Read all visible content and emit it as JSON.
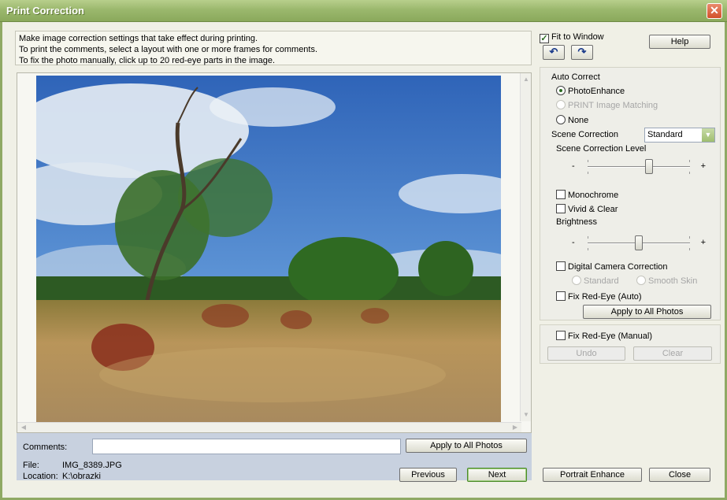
{
  "window": {
    "title": "Print Correction",
    "close_glyph": "✕"
  },
  "instructions": [
    "Make image correction settings that take effect during printing.",
    "To print the comments, select a layout with one or more frames for comments.",
    "To fix the photo manually, click up to 20 red-eye parts in the image."
  ],
  "view": {
    "fit_to_window_label": "Fit to Window",
    "fit_to_window_checked": true,
    "help_label": "Help",
    "rotate_left_glyph": "↶",
    "rotate_right_glyph": "↷"
  },
  "auto_correct": {
    "heading": "Auto Correct",
    "options": [
      {
        "label": "PhotoEnhance",
        "selected": true,
        "enabled": true
      },
      {
        "label": "PRINT Image Matching",
        "selected": false,
        "enabled": false
      },
      {
        "label": "None",
        "selected": false,
        "enabled": true
      }
    ],
    "scene_correction_label": "Scene Correction",
    "scene_correction_value": "Standard",
    "scene_level_label": "Scene Correction Level",
    "scene_level_value": 0.6,
    "monochrome_label": "Monochrome",
    "vivid_label": "Vivid & Clear",
    "brightness_label": "Brightness",
    "brightness_value": 0.5,
    "digital_camera_label": "Digital Camera Correction",
    "dc_options": [
      "Standard",
      "Smooth Skin"
    ],
    "fix_redeye_auto_label": "Fix Red-Eye (Auto)",
    "apply_all_label": "Apply to All Photos",
    "minus": "-",
    "plus": "+"
  },
  "manual": {
    "fix_redeye_manual_label": "Fix Red-Eye (Manual)",
    "undo_label": "Undo",
    "clear_label": "Clear"
  },
  "bottom": {
    "comments_label": "Comments:",
    "comments_value": "",
    "apply_all_label": "Apply to All Photos",
    "file_label": "File:",
    "file_value": "IMG_8389.JPG",
    "location_label": "Location:",
    "location_value": "K:\\obrazki",
    "previous_label": "Previous",
    "next_label": "Next"
  },
  "footer": {
    "portrait_enhance_label": "Portrait Enhance",
    "close_label": "Close"
  },
  "icons": {
    "scroll_up": "▲",
    "scroll_down": "▼",
    "scroll_left": "◀",
    "scroll_right": "▶",
    "dropdown": "▼"
  }
}
